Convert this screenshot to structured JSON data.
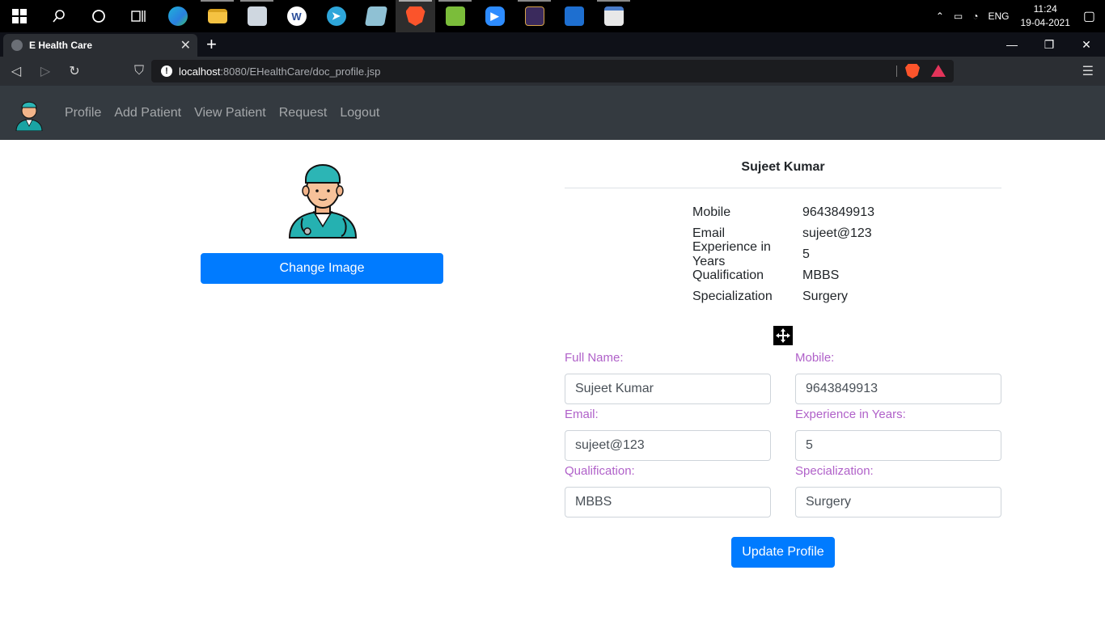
{
  "taskbar": {
    "apps": [
      "search-icon",
      "cortana-icon",
      "task-view-icon",
      "edge-icon",
      "file-explorer-icon",
      "monitor-app-icon",
      "word-app-icon",
      "telegram-icon",
      "notes-app-icon",
      "brave-icon",
      "sheet-app-icon",
      "zoom-icon",
      "game-app-icon",
      "photos-icon",
      "window-app-icon"
    ],
    "language": "ENG",
    "time": "11:24",
    "date": "19-04-2021"
  },
  "browser": {
    "tab_title": "E Health Care",
    "url_host": "localhost",
    "url_path": ":8080/EHealthCare/doc_profile.jsp"
  },
  "nav": {
    "items": [
      "Profile",
      "Add Patient",
      "View Patient",
      "Request",
      "Logout"
    ]
  },
  "profile": {
    "change_image_label": "Change Image",
    "name": "Sujeet Kumar",
    "details": [
      {
        "key": "Mobile",
        "value": "9643849913"
      },
      {
        "key": "Email",
        "value": "sujeet@123"
      },
      {
        "key": "Experience in Years",
        "value": "5"
      },
      {
        "key": "Qualification",
        "value": "MBBS"
      },
      {
        "key": "Specialization",
        "value": "Surgery"
      }
    ]
  },
  "form": {
    "full_name_label": "Full Name:",
    "full_name_value": "Sujeet Kumar",
    "mobile_label": "Mobile:",
    "mobile_value": "9643849913",
    "email_label": "Email:",
    "email_value": "sujeet@123",
    "experience_label": "Experience in Years:",
    "experience_value": "5",
    "qualification_label": "Qualification:",
    "qualification_value": "MBBS",
    "specialization_label": "Specialization:",
    "specialization_value": "Surgery",
    "submit_label": "Update Profile"
  },
  "colors": {
    "primary": "#007bff",
    "navbar": "#343a40",
    "label": "#b061c9"
  }
}
